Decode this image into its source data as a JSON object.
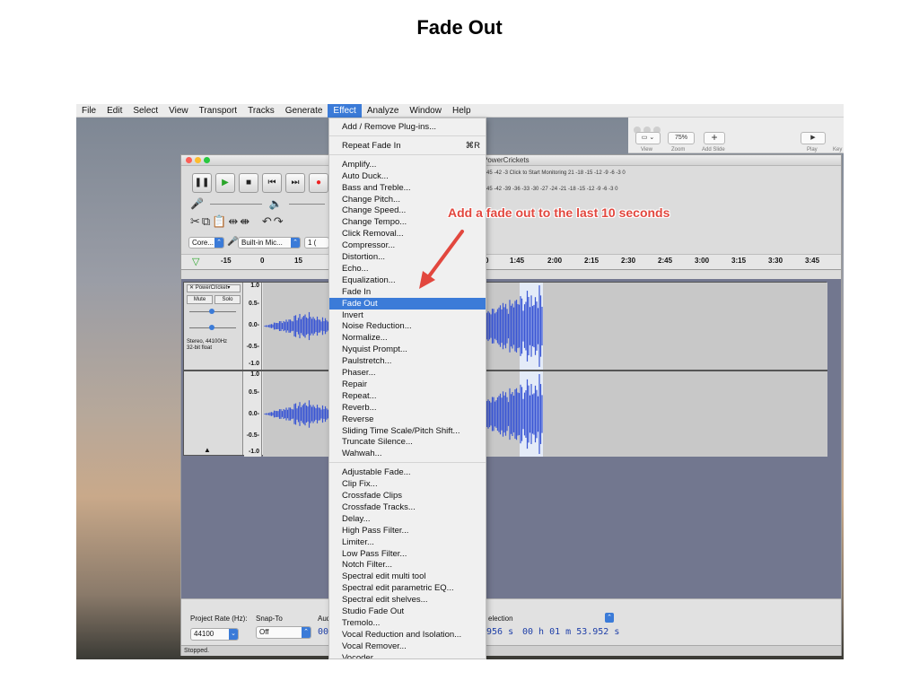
{
  "slide": {
    "title": "Fade Out"
  },
  "menubar": {
    "items": [
      "File",
      "Edit",
      "Select",
      "View",
      "Transport",
      "Tracks",
      "Generate",
      "Effect",
      "Analyze",
      "Window",
      "Help"
    ],
    "active": "Effect"
  },
  "keynote": {
    "zoom": "75%",
    "labels": [
      "View",
      "Zoom",
      "Add Slide",
      "Play",
      "Key"
    ]
  },
  "audacity": {
    "window_title": "PowerCrickets",
    "meter_top": "-45 -42 -3 Click to Start Monitoring 21 -18 -15 -12 -9 -6 -3 0",
    "meter_bottom": "-45 -42 -39 -36 -33 -30 -27 -24 -21 -18 -15 -12 -9 -6 -3 0",
    "host_select": "Core...",
    "input_select": "Built-in Mic...",
    "channels_select": "1 (",
    "ruler_ticks": [
      "-15",
      "0",
      "15",
      "0",
      "1:45",
      "2:00",
      "2:15",
      "2:30",
      "2:45",
      "3:00",
      "3:15",
      "3:30",
      "3:45"
    ],
    "track": {
      "name": "PowerCricket",
      "mute": "Mute",
      "solo": "Solo",
      "info": "Stereo, 44100Hz\n32-bit float",
      "scale": [
        "1.0",
        "0.5-",
        "0.0-",
        "-0.5-",
        "-1.0"
      ]
    },
    "bottom": {
      "project_rate_label": "Project Rate (Hz):",
      "project_rate": "44100",
      "snap_label": "Snap-To",
      "snap": "Off",
      "audio_label": "Aud",
      "selection_label": "election",
      "start_time": "956 s",
      "end_time": "00 h 01 m 53.952 s",
      "start_prefix": "00"
    },
    "status": "Stopped."
  },
  "effect_menu": {
    "groups": [
      [
        {
          "label": "Add / Remove Plug-ins..."
        }
      ],
      [
        {
          "label": "Repeat Fade In",
          "shortcut": "⌘R"
        }
      ],
      [
        {
          "label": "Amplify..."
        },
        {
          "label": "Auto Duck..."
        },
        {
          "label": "Bass and Treble..."
        },
        {
          "label": "Change Pitch..."
        },
        {
          "label": "Change Speed..."
        },
        {
          "label": "Change Tempo..."
        },
        {
          "label": "Click Removal..."
        },
        {
          "label": "Compressor..."
        },
        {
          "label": "Distortion..."
        },
        {
          "label": "Echo..."
        },
        {
          "label": "Equalization..."
        },
        {
          "label": "Fade In"
        },
        {
          "label": "Fade Out",
          "highlighted": true
        },
        {
          "label": "Invert"
        },
        {
          "label": "Noise Reduction..."
        },
        {
          "label": "Normalize..."
        },
        {
          "label": "Nyquist Prompt..."
        },
        {
          "label": "Paulstretch..."
        },
        {
          "label": "Phaser..."
        },
        {
          "label": "Repair"
        },
        {
          "label": "Repeat..."
        },
        {
          "label": "Reverb..."
        },
        {
          "label": "Reverse"
        },
        {
          "label": "Sliding Time Scale/Pitch Shift..."
        },
        {
          "label": "Truncate Silence..."
        },
        {
          "label": "Wahwah..."
        }
      ],
      [
        {
          "label": "Adjustable Fade..."
        },
        {
          "label": "Clip Fix..."
        },
        {
          "label": "Crossfade Clips"
        },
        {
          "label": "Crossfade Tracks..."
        },
        {
          "label": "Delay..."
        },
        {
          "label": "High Pass Filter..."
        },
        {
          "label": "Limiter..."
        },
        {
          "label": "Low Pass Filter..."
        },
        {
          "label": "Notch Filter..."
        },
        {
          "label": "Spectral edit multi tool"
        },
        {
          "label": "Spectral edit parametric EQ..."
        },
        {
          "label": "Spectral edit shelves..."
        },
        {
          "label": "Studio Fade Out"
        },
        {
          "label": "Tremolo..."
        },
        {
          "label": "Vocal Reduction and Isolation..."
        },
        {
          "label": "Vocal Remover..."
        },
        {
          "label": "Vocoder..."
        }
      ]
    ]
  },
  "annotation": {
    "text": "Add a fade out to the last 10 seconds",
    "color": "#e2473e"
  },
  "colors": {
    "accent": "#3b7bd8",
    "waveform": "#3a56d4",
    "tracks_bg": "#72778f"
  }
}
